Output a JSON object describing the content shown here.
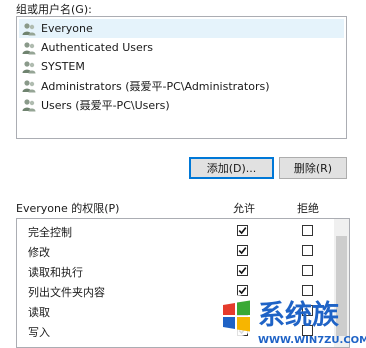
{
  "groups_label": "组或用户名(G):",
  "principals": [
    {
      "name": "Everyone",
      "selected": true
    },
    {
      "name": "Authenticated Users",
      "selected": false
    },
    {
      "name": "SYSTEM",
      "selected": false
    },
    {
      "name": "Administrators (聂爱平-PC\\Administrators)",
      "selected": false
    },
    {
      "name": "Users (聂爱平-PC\\Users)",
      "selected": false
    }
  ],
  "buttons": {
    "add": "添加(D)...",
    "remove": "删除(R)"
  },
  "permissions": {
    "header_label": "Everyone 的权限(P)",
    "allow_header": "允许",
    "deny_header": "拒绝",
    "rows": [
      {
        "name": "完全控制",
        "allow": true,
        "deny": false
      },
      {
        "name": "修改",
        "allow": true,
        "deny": false
      },
      {
        "name": "读取和执行",
        "allow": true,
        "deny": false
      },
      {
        "name": "列出文件夹内容",
        "allow": true,
        "deny": false
      },
      {
        "name": "读取",
        "allow": true,
        "deny": false
      },
      {
        "name": "写入",
        "allow": true,
        "deny": false
      }
    ]
  },
  "watermark": {
    "brand": "系统族",
    "url": "WWW.WIN7ZU.COM",
    "colors": {
      "blue": "#1f63c6",
      "red": "#e53b2c",
      "green": "#3aa935",
      "yellow": "#f7b500"
    }
  },
  "colors": {
    "selection": "#e5f3fb",
    "default_button_border": "#0078d7",
    "button_face": "#e1e1e1"
  }
}
